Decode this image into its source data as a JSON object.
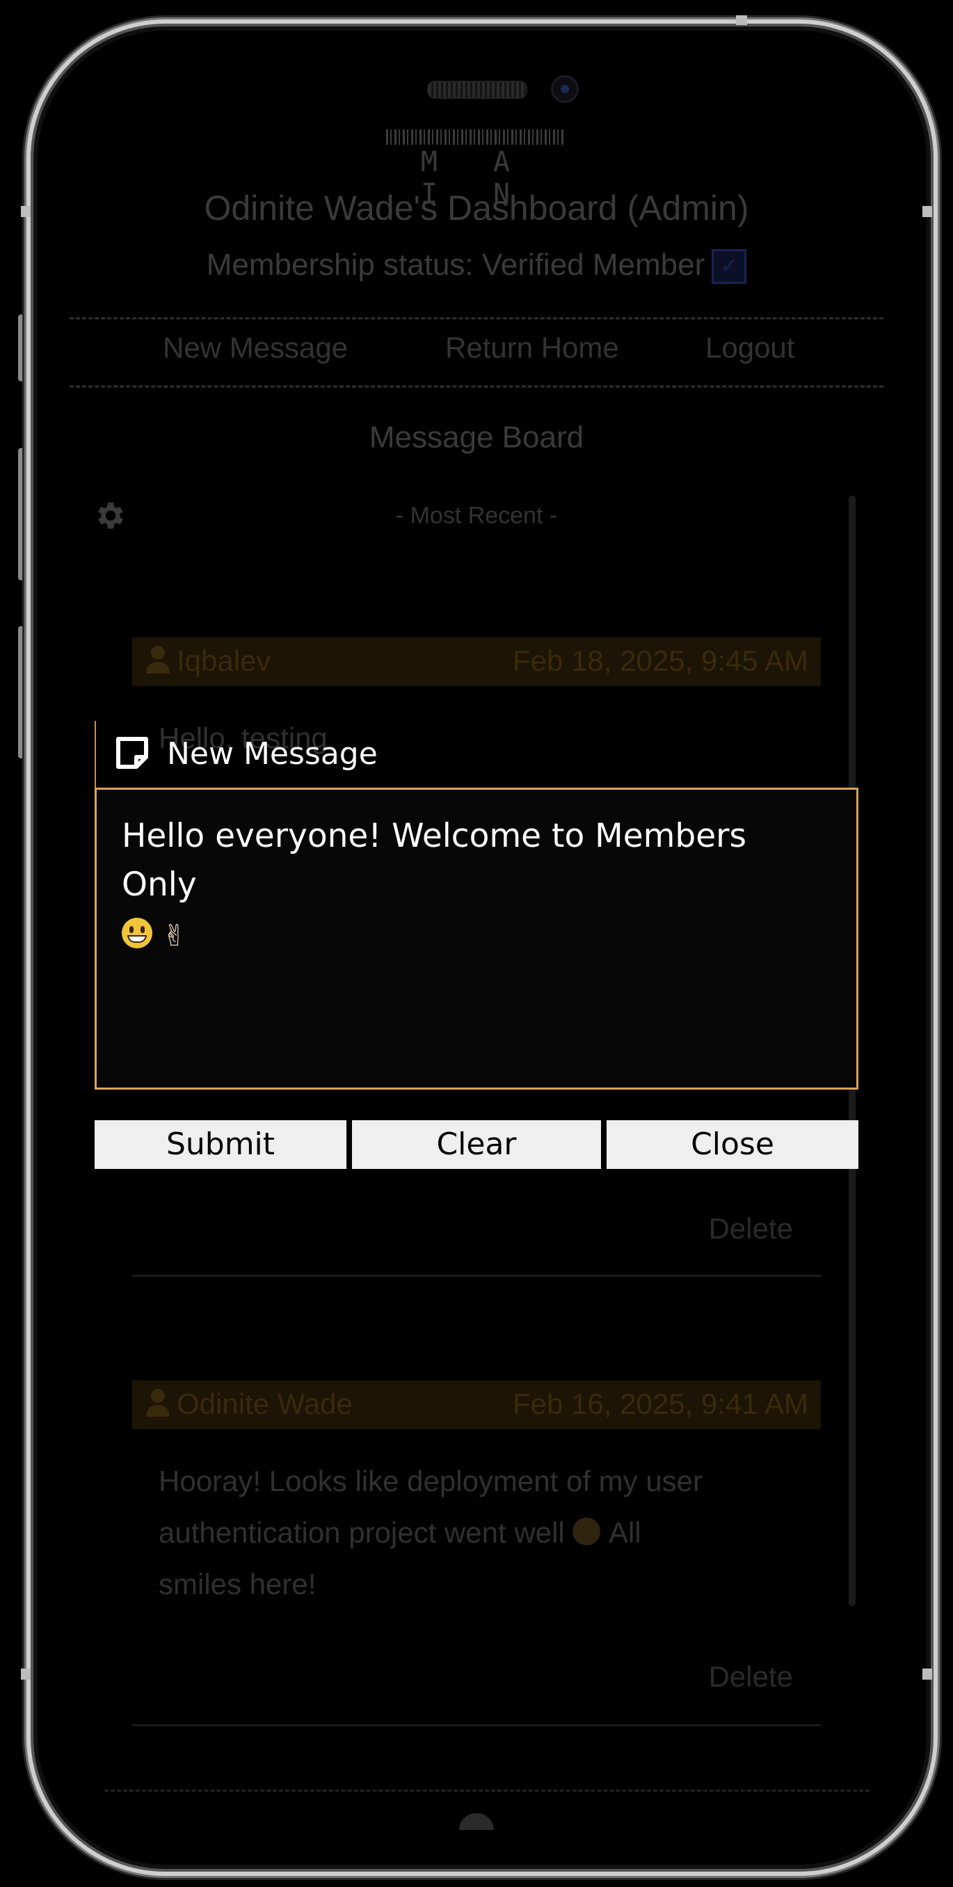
{
  "header": {
    "logo_text": "M A I N",
    "dashboard_title": "Odinite Wade's Dashboard (Admin)",
    "membership_status": "Membership status: Verified Member"
  },
  "nav": {
    "new_message": "New Message",
    "return_home": "Return Home",
    "logout": "Logout"
  },
  "board": {
    "title": "Message Board",
    "sort_label": "- Most Recent -",
    "messages": [
      {
        "user": "Iqbalev",
        "date": "Feb 18, 2025, 9:45 AM",
        "body": "Hello, testing",
        "delete_label": "Delete"
      },
      {
        "user": "Odinite Wade",
        "date": "Feb 16, 2025, 9:41 AM",
        "body_line1": "Hooray! Looks like deployment of my user",
        "body_line2": "authentication project went well",
        "body_line2_suffix": "All",
        "body_line3": "smiles here!",
        "delete_label": "Delete"
      }
    ]
  },
  "modal": {
    "title": "New Message",
    "textarea_value": "Hello everyone! Welcome to Members Only",
    "submit_label": "Submit",
    "clear_label": "Clear",
    "close_label": "Close"
  },
  "colors": {
    "accent_border": "#d9a35a",
    "button_bg": "#efefef",
    "message_header_bg": "#1c1404"
  },
  "icons": [
    "gear-icon",
    "user-icon",
    "note-icon",
    "verified-icon",
    "grinning-face-emoji",
    "victory-hand-emoji"
  ]
}
